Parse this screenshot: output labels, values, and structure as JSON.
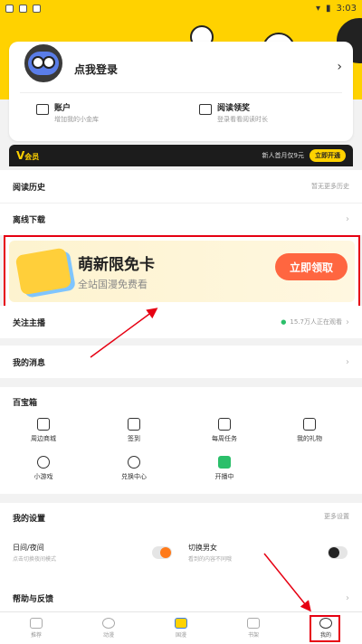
{
  "status_bar": {
    "time": "3:03"
  },
  "profile": {
    "login_label": "点我登录",
    "chevron": "›"
  },
  "quick_items": [
    {
      "title": "账户",
      "subtitle": "增加我的小金库",
      "icon": "wallet-icon"
    },
    {
      "title": "阅读领奖",
      "subtitle": "登录看看阅读时长",
      "icon": "gift-icon"
    }
  ],
  "vip": {
    "logo": "V",
    "logo_sub": "会员",
    "promo": "新人首月仅9元",
    "button": "立即开通"
  },
  "rows": {
    "history": {
      "label": "阅读历史",
      "right": "暂无更多历史"
    },
    "offline": {
      "label": "离线下载"
    },
    "follow": {
      "label": "关注主播",
      "right": "15.7万人正在观看"
    },
    "messages": {
      "label": "我的消息"
    },
    "help": {
      "label": "帮助与反馈"
    }
  },
  "banner": {
    "title": "萌新限免卡",
    "subtitle": "全站国漫免费看",
    "button": "立即领取"
  },
  "treasure": {
    "title": "百宝箱",
    "items": [
      "周边商城",
      "签到",
      "每周任务",
      "我的礼物",
      "小游戏",
      "兑换中心",
      "开播中"
    ]
  },
  "settings": {
    "title": "我的设置",
    "more": "更多设置",
    "items": [
      {
        "title": "日间/夜间",
        "subtitle": "点击切换夜间模式"
      },
      {
        "title": "切换男女",
        "subtitle": "看到的内容不同哦"
      }
    ]
  },
  "bottom_nav": [
    "推荐",
    "动漫",
    "国漫",
    "书架",
    "我的"
  ],
  "colors": {
    "brand": "#ffd200",
    "accent": "#ff6640",
    "highlight": "#e60012"
  }
}
